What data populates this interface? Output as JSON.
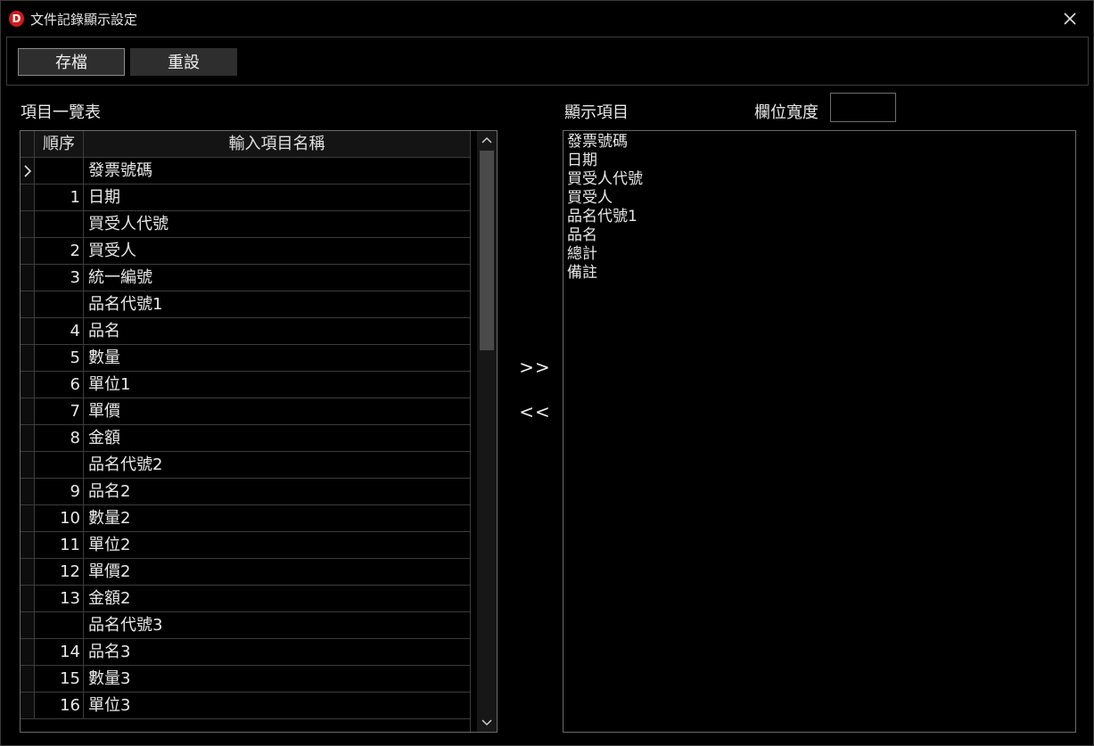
{
  "window": {
    "title": "文件記錄顯示設定",
    "logo_letter": "D",
    "accent_color": "#d01b1b"
  },
  "toolbar": {
    "save_label": "存檔",
    "reset_label": "重設"
  },
  "labels": {
    "item_list": "項目一覽表",
    "display_items": "顯示項目",
    "column_width": "欄位寬度"
  },
  "column_width_value": "",
  "grid": {
    "headers": {
      "seq": "順序",
      "name": "輸入項目名稱"
    },
    "rows": [
      {
        "seq": "",
        "name": "發票號碼",
        "current": true
      },
      {
        "seq": "1",
        "name": "日期"
      },
      {
        "seq": "",
        "name": "買受人代號"
      },
      {
        "seq": "2",
        "name": "買受人"
      },
      {
        "seq": "3",
        "name": "統一編號"
      },
      {
        "seq": "",
        "name": "品名代號1"
      },
      {
        "seq": "4",
        "name": "品名"
      },
      {
        "seq": "5",
        "name": "數量"
      },
      {
        "seq": "6",
        "name": "單位1"
      },
      {
        "seq": "7",
        "name": "單價"
      },
      {
        "seq": "8",
        "name": "金額"
      },
      {
        "seq": "",
        "name": "品名代號2"
      },
      {
        "seq": "9",
        "name": "品名2"
      },
      {
        "seq": "10",
        "name": "數量2"
      },
      {
        "seq": "11",
        "name": "單位2"
      },
      {
        "seq": "12",
        "name": "單價2"
      },
      {
        "seq": "13",
        "name": "金額2"
      },
      {
        "seq": "",
        "name": "品名代號3"
      },
      {
        "seq": "14",
        "name": "品名3"
      },
      {
        "seq": "15",
        "name": "數量3"
      },
      {
        "seq": "16",
        "name": "單位3"
      }
    ]
  },
  "transfer": {
    "add_label": ">>",
    "remove_label": "<<"
  },
  "display_list": [
    "發票號碼",
    "日期",
    "買受人代號",
    "買受人",
    "品名代號1",
    "品名",
    "總計",
    "備註"
  ]
}
